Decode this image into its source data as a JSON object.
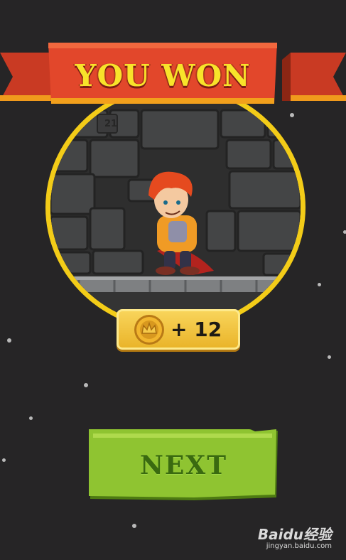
{
  "banner": {
    "title": "YOU WON"
  },
  "scene": {
    "level_number": "21"
  },
  "reward": {
    "icon": "crown-coin-icon",
    "amount_text": "+ 12"
  },
  "next_button": {
    "label": "NEXT"
  },
  "watermark": {
    "logo": "Baidu经验",
    "url": "jingyan.baidu.com"
  },
  "colors": {
    "background": "#262526",
    "ribbon": "#e2472b",
    "ring": "#f3cc18",
    "title_text": "#f8e32a",
    "button": "#8fc431",
    "button_text": "#3a6a10"
  }
}
